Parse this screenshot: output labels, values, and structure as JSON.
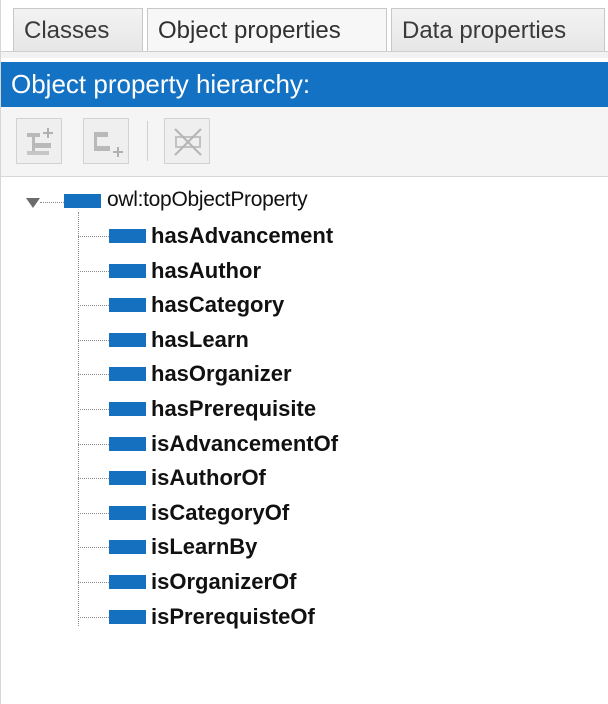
{
  "tabs": [
    {
      "label": "Classes",
      "active": false
    },
    {
      "label": "Object properties",
      "active": true
    },
    {
      "label": "Data properties",
      "active": false
    }
  ],
  "view": {
    "title": "Object property hierarchy:"
  },
  "toolbar": {
    "buttons": [
      {
        "name": "add-sub-property-button",
        "icon": "add-sub-property-icon",
        "enabled": false
      },
      {
        "name": "add-sibling-property-button",
        "icon": "add-sibling-property-icon",
        "enabled": false
      },
      {
        "name": "delete-property-button",
        "icon": "delete-property-icon",
        "enabled": false
      }
    ]
  },
  "tree": {
    "root": {
      "label": "owl:topObjectProperty",
      "expanded": true,
      "icon": "object-property-icon"
    },
    "children": [
      {
        "label": "hasAdvancement"
      },
      {
        "label": "hasAuthor"
      },
      {
        "label": "hasCategory"
      },
      {
        "label": "hasLearn"
      },
      {
        "label": "hasOrganizer"
      },
      {
        "label": "hasPrerequisite"
      },
      {
        "label": "isAdvancementOf"
      },
      {
        "label": "isAuthorOf"
      },
      {
        "label": "isCategoryOf"
      },
      {
        "label": "isLearnBy"
      },
      {
        "label": "isOrganizerOf"
      },
      {
        "label": "isPrerequisteOf"
      }
    ]
  },
  "colors": {
    "header_bg": "#1472c4",
    "property_icon": "#1570c0"
  }
}
